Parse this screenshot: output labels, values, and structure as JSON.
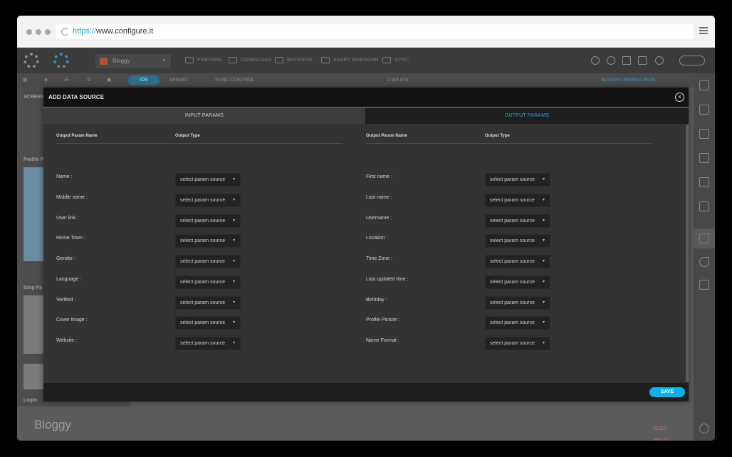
{
  "browser": {
    "url_protocol": "https://",
    "url_host": "www.configure.it"
  },
  "app": {
    "project_name": "Bloggy",
    "toolbar": {
      "preview": "PREVIEW",
      "download": "DOWNLOAD",
      "backend": "BACKEND",
      "asset_manager": "ASSET MANAGER",
      "sync": "SYNC"
    },
    "subbar": {
      "ios": "iOS",
      "android": "Android",
      "sync_control": "SYNC CONTROL",
      "pager": "1 out of 6",
      "breadcrumb": "BLOGGY / PROFILE PAGE"
    },
    "left_panel": {
      "screen_list": "SCREEN LI",
      "profile_section": "Profile P",
      "blog_section": "Blog Pa",
      "login_section": "Login",
      "bloggy_card": "Bloggy"
    },
    "need_help": "NEED HELP?"
  },
  "modal": {
    "title": "ADD DATA SOURCE",
    "tabs": {
      "input": "INPUT PARAMS",
      "output": "OUTPUT PARAMS"
    },
    "column_headers": {
      "name": "Output Param Name",
      "type": "Output Type"
    },
    "select_placeholder": "select param source",
    "left_params": [
      "Name :",
      "Middle name :",
      "User link :",
      "Home Town :",
      "Gender :",
      "Language :",
      "Verified :",
      "Cover image :",
      "Website :"
    ],
    "right_params": [
      "First name :",
      "Last name :",
      "Username :",
      "Location :",
      "Time Zone :",
      "Last updated time :",
      "Birthday :",
      "Profile Picture :",
      "Name Format :"
    ],
    "save_label": "SAVE"
  }
}
